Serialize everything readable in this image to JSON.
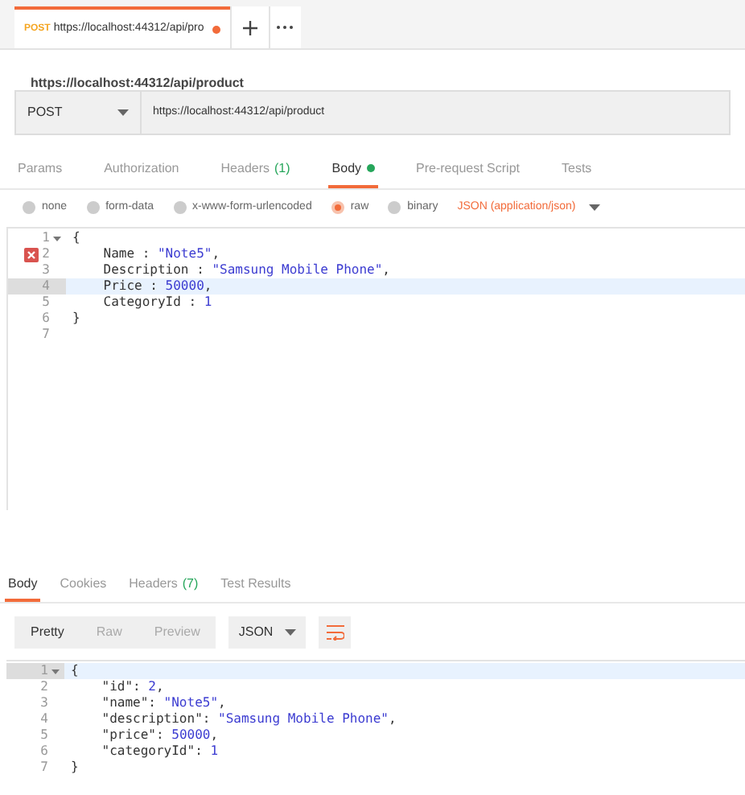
{
  "request_tab": {
    "method": "POST",
    "title": "https://localhost:44312/api/pro",
    "unsaved": true
  },
  "request_name": "https://localhost:44312/api/product",
  "url_bar": {
    "method": "POST",
    "url": "https://localhost:44312/api/product"
  },
  "request_tabs": [
    {
      "label": "Params",
      "selected": false
    },
    {
      "label": "Authorization",
      "selected": false
    },
    {
      "label": "Headers",
      "count": "(1)",
      "selected": false
    },
    {
      "label": "Body",
      "dot": true,
      "selected": true
    },
    {
      "label": "Pre-request Script",
      "selected": false
    },
    {
      "label": "Tests",
      "selected": false
    }
  ],
  "body_types": [
    {
      "label": "none",
      "selected": false
    },
    {
      "label": "form-data",
      "selected": false
    },
    {
      "label": "x-www-form-urlencoded",
      "selected": false
    },
    {
      "label": "raw",
      "selected": true
    },
    {
      "label": "binary",
      "selected": false
    }
  ],
  "content_type": "JSON (application/json)",
  "request_editor": [
    {
      "number": "1",
      "fold": true,
      "error": false,
      "active": false,
      "tokens": [
        {
          "text": "{",
          "kind": "punct"
        }
      ]
    },
    {
      "number": "2",
      "fold": false,
      "error": true,
      "active": false,
      "tokens": [
        {
          "text": "    Name : ",
          "kind": "key"
        },
        {
          "text": "\"Note5\"",
          "kind": "string"
        },
        {
          "text": ",",
          "kind": "punct"
        }
      ]
    },
    {
      "number": "3",
      "fold": false,
      "error": false,
      "active": false,
      "tokens": [
        {
          "text": "    Description : ",
          "kind": "key"
        },
        {
          "text": "\"Samsung Mobile Phone\"",
          "kind": "string"
        },
        {
          "text": ",",
          "kind": "punct"
        }
      ]
    },
    {
      "number": "4",
      "fold": false,
      "error": false,
      "active": true,
      "tokens": [
        {
          "text": "    Price : ",
          "kind": "key"
        },
        {
          "text": "50000",
          "kind": "number"
        },
        {
          "text": ",",
          "kind": "punct"
        }
      ]
    },
    {
      "number": "5",
      "fold": false,
      "error": false,
      "active": false,
      "tokens": [
        {
          "text": "    CategoryId : ",
          "kind": "key"
        },
        {
          "text": "1",
          "kind": "number"
        }
      ]
    },
    {
      "number": "6",
      "fold": false,
      "error": false,
      "active": false,
      "tokens": [
        {
          "text": "}",
          "kind": "punct"
        }
      ]
    },
    {
      "number": "7",
      "fold": false,
      "error": false,
      "active": false
    }
  ],
  "response_tabs": [
    {
      "label": "Body",
      "selected": true
    },
    {
      "label": "Cookies",
      "selected": false
    },
    {
      "label": "Headers",
      "count": "(7)",
      "selected": false
    },
    {
      "label": "Test Results",
      "selected": false
    }
  ],
  "view_modes": [
    {
      "label": "Pretty",
      "selected": true
    },
    {
      "label": "Raw",
      "selected": false
    },
    {
      "label": "Preview",
      "selected": false
    }
  ],
  "format": "JSON",
  "response_editor": [
    {
      "number": "1",
      "fold": true,
      "error": false,
      "active": true,
      "tokens": [
        {
          "text": "{",
          "kind": "punct"
        }
      ]
    },
    {
      "number": "2",
      "fold": false,
      "error": false,
      "active": false,
      "tokens": [
        {
          "text": "    \"id\": ",
          "kind": "key"
        },
        {
          "text": "2",
          "kind": "number"
        },
        {
          "text": ",",
          "kind": "punct"
        }
      ]
    },
    {
      "number": "3",
      "fold": false,
      "error": false,
      "active": false,
      "tokens": [
        {
          "text": "    \"name\": ",
          "kind": "key"
        },
        {
          "text": "\"Note5\"",
          "kind": "string"
        },
        {
          "text": ",",
          "kind": "punct"
        }
      ]
    },
    {
      "number": "4",
      "fold": false,
      "error": false,
      "active": false,
      "tokens": [
        {
          "text": "    \"description\": ",
          "kind": "key"
        },
        {
          "text": "\"Samsung Mobile Phone\"",
          "kind": "string"
        },
        {
          "text": ",",
          "kind": "punct"
        }
      ]
    },
    {
      "number": "5",
      "fold": false,
      "error": false,
      "active": false,
      "tokens": [
        {
          "text": "    \"price\": ",
          "kind": "key"
        },
        {
          "text": "50000",
          "kind": "number"
        },
        {
          "text": ",",
          "kind": "punct"
        }
      ]
    },
    {
      "number": "6",
      "fold": false,
      "error": false,
      "active": false,
      "tokens": [
        {
          "text": "    \"categoryId\": ",
          "kind": "key"
        },
        {
          "text": "1",
          "kind": "number"
        }
      ]
    },
    {
      "number": "7",
      "fold": false,
      "error": false,
      "active": false,
      "tokens": [
        {
          "text": "}",
          "kind": "punct"
        }
      ]
    }
  ]
}
